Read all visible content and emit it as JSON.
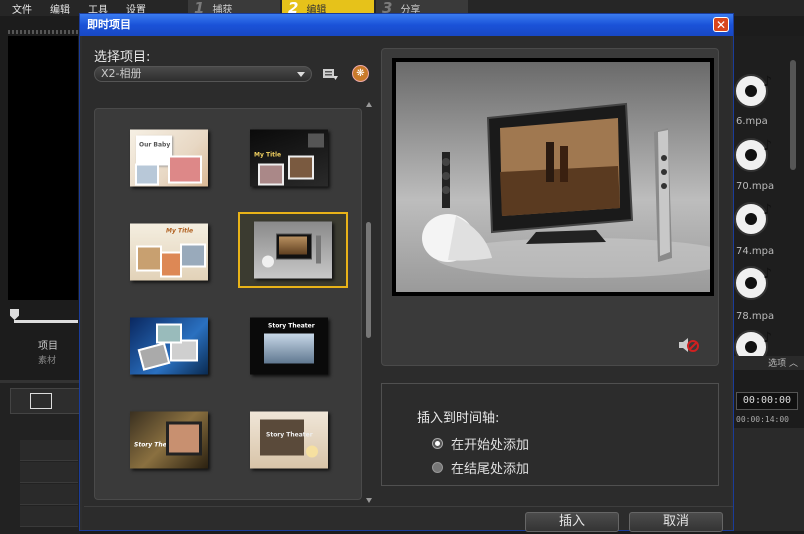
{
  "app": {
    "menu": [
      "文件",
      "编辑",
      "工具",
      "设置"
    ],
    "steps": [
      {
        "num": "1",
        "label": "捕获"
      },
      {
        "num": "2",
        "label": "编辑"
      },
      {
        "num": "3",
        "label": "分享"
      }
    ],
    "project_label": "项目",
    "source_label": "素材",
    "library_files": [
      "6.mpa",
      "70.mpa",
      "74.mpa",
      "78.mpa"
    ],
    "options_label": "选项",
    "timecode": "00:00:00",
    "ruler_time": "00:00:14:00"
  },
  "dialog": {
    "title": "即时项目",
    "select_label": "选择项目:",
    "dropdown_value": "X2-相册",
    "thumbnails": [
      {
        "caption": "Our Baby",
        "selected": false
      },
      {
        "caption": "My Title",
        "selected": false
      },
      {
        "caption": "My Title",
        "selected": false
      },
      {
        "caption": "",
        "selected": true
      },
      {
        "caption": "",
        "selected": false
      },
      {
        "caption": "Story Theater",
        "selected": false
      },
      {
        "caption": "Story Theater",
        "selected": false
      },
      {
        "caption": "Story Theater",
        "selected": false
      }
    ],
    "insert_title": "插入到时间轴:",
    "radio_options": [
      {
        "label": "在开始处添加",
        "checked": true
      },
      {
        "label": "在结尾处添加",
        "checked": false
      }
    ],
    "insert_button": "插入",
    "cancel_button": "取消"
  },
  "colors": {
    "titlebar": "#1a52d8",
    "active_step": "#e6c21a",
    "selection": "#e8b318",
    "close": "#d8461c"
  },
  "icons": [
    "close-icon",
    "dropdown-arrow-icon",
    "library-options-icon",
    "help-icon",
    "mute-icon",
    "music-file-icon",
    "film-icon"
  ]
}
